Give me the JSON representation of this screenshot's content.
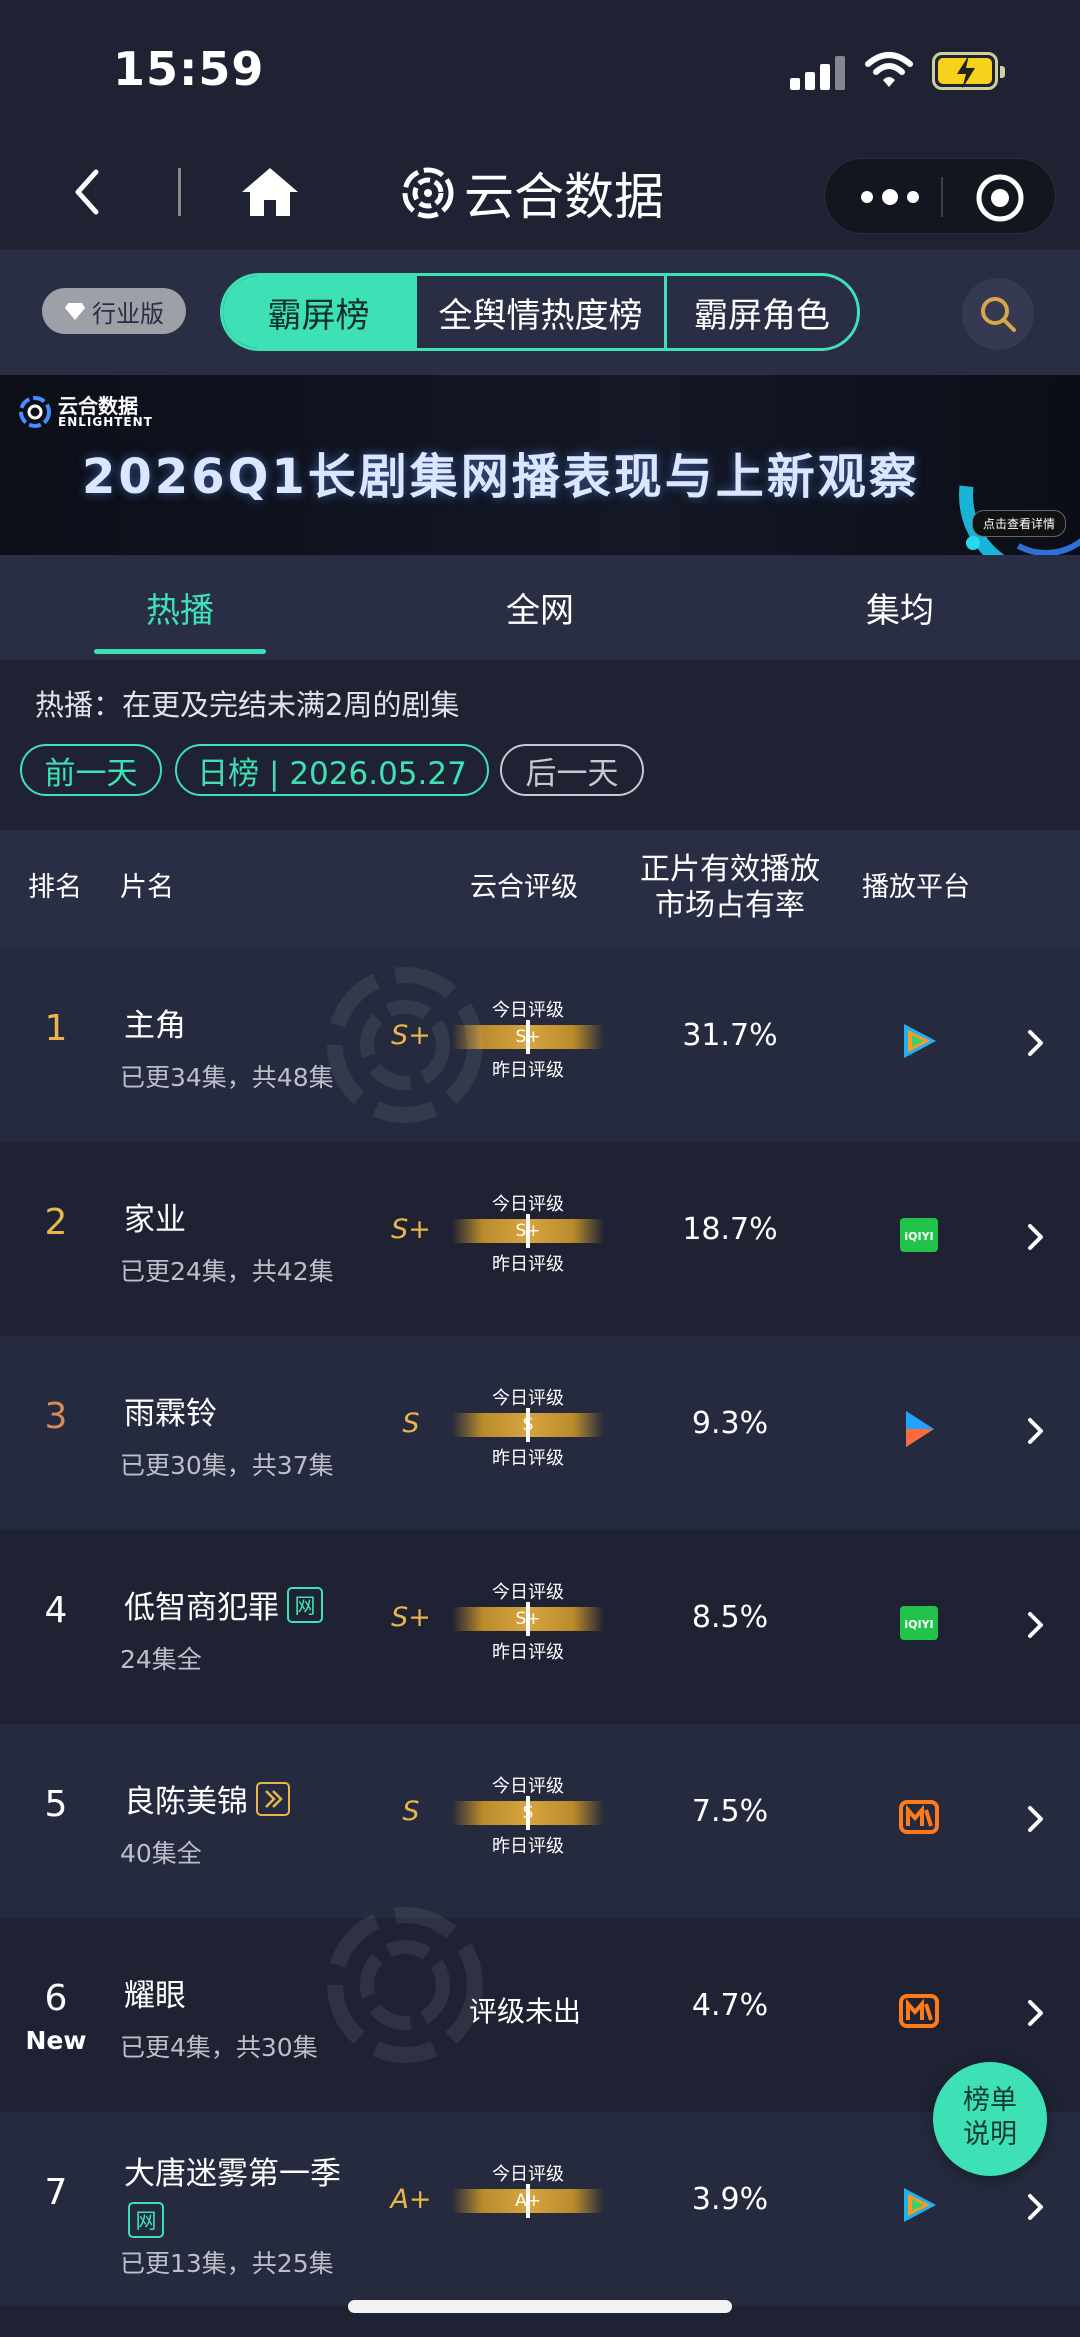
{
  "status_bar": {
    "time": "15:59"
  },
  "nav": {
    "title": "云合数据"
  },
  "topbar": {
    "badge": "行业版",
    "segments": [
      "霸屏榜",
      "全舆情热度榜",
      "霸屏角色"
    ],
    "active_segment": "霸屏榜"
  },
  "banner": {
    "logo_cn": "云合数据",
    "logo_en": "ENLIGHTENT",
    "title": "2026Q1长剧集网播表现与上新观察",
    "cta": "点击查看详情"
  },
  "subtabs": [
    "热播",
    "全网",
    "集均"
  ],
  "info": {
    "description": "热播：在更及完结未满2周的剧集",
    "prev": "前一天",
    "date": "日榜 | 2026.05.27",
    "next": "后一天"
  },
  "table_header": {
    "rank": "排名",
    "name": "片名",
    "rating": "云合评级",
    "share_line1": "正片有效播放",
    "share_line2": "市场占有率",
    "platform": "播放平台"
  },
  "grade_labels": {
    "today": "今日评级",
    "yesterday": "昨日评级"
  },
  "rows": [
    {
      "rank": "1",
      "title": "主角",
      "sub": "已更34集，共48集",
      "grade": "S+",
      "bar_grade": "S+",
      "share": "31.7%",
      "platform": "tencent-video"
    },
    {
      "rank": "2",
      "title": "家业",
      "sub": "已更24集，共42集",
      "grade": "S+",
      "bar_grade": "S+",
      "share": "18.7%",
      "platform": "iqiyi"
    },
    {
      "rank": "3",
      "title": "雨霖铃",
      "sub": "已更30集，共37集",
      "grade": "S",
      "bar_grade": "S",
      "share": "9.3%",
      "platform": "youku"
    },
    {
      "rank": "4",
      "title": "低智商犯罪",
      "tag": "网",
      "sub": "24集全",
      "grade": "S+",
      "bar_grade": "S+",
      "share": "8.5%",
      "platform": "iqiyi"
    },
    {
      "rank": "5",
      "title": "良陈美锦",
      "sub": "40集全",
      "grade": "S",
      "bar_grade": "S",
      "share": "7.5%",
      "platform": "mango-tv"
    },
    {
      "rank": "6",
      "new": "New",
      "title": "耀眼",
      "sub": "已更4集，共30集",
      "unrated": "评级未出",
      "share": "4.7%",
      "platform": "mango-tv"
    },
    {
      "rank": "7",
      "title": "大唐迷雾第一季",
      "tag": "网",
      "sub": "已更13集，共25集",
      "grade": "A+",
      "bar_grade": "A+",
      "share": "3.9%",
      "platform": "tencent-video"
    }
  ],
  "float_button": {
    "line1": "榜单",
    "line2": "说明"
  },
  "colors": {
    "accent": "#3ee0b6",
    "gold": "#e8b64a",
    "background": "#1f2233",
    "panel": "#2a2e44"
  }
}
